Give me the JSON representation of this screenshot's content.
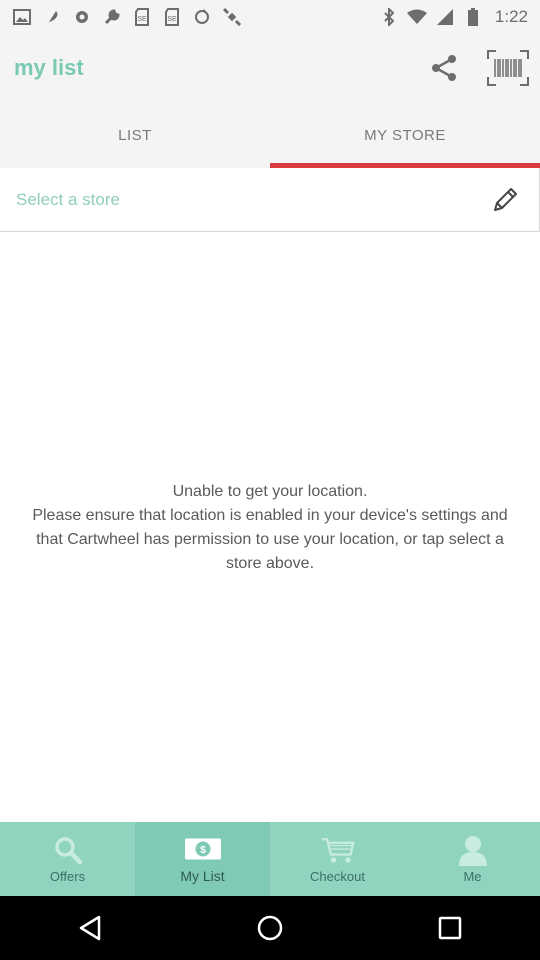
{
  "status_bar": {
    "time": "1:22",
    "icons": [
      "image-icon",
      "feather-icon",
      "settings-icon",
      "wrench-icon",
      "sdcard-icon",
      "sdcard-icon",
      "sync-icon",
      "satellite-icon",
      "bluetooth-icon",
      "wifi-icon",
      "signal-icon",
      "battery-icon"
    ]
  },
  "app_bar": {
    "title": "my list",
    "actions": [
      "share-icon",
      "barcode-scan-icon"
    ]
  },
  "tabs": [
    {
      "label": "LIST",
      "active": false
    },
    {
      "label": "MY STORE",
      "active": true
    }
  ],
  "store_selector": {
    "label": "Select a store",
    "icon": "pencil-icon"
  },
  "message": "Unable to get your location.\nPlease ensure that location is enabled in your device's settings and that Cartwheel has permission to use your location, or tap select a store above.",
  "bottom_nav": [
    {
      "label": "Offers",
      "icon": "search-icon",
      "active": false
    },
    {
      "label": "My List",
      "icon": "dollar-tag-icon",
      "active": true
    },
    {
      "label": "Checkout",
      "icon": "cart-icon",
      "active": false
    },
    {
      "label": "Me",
      "icon": "person-icon",
      "active": false
    }
  ],
  "system_nav": [
    "back-icon",
    "home-icon",
    "recents-icon"
  ],
  "colors": {
    "accent_teal": "#79c9b3",
    "tab_indicator": "#d93b3f",
    "bottom_nav_bg": "#90d4c0",
    "bottom_nav_active": "#7fcab4"
  }
}
